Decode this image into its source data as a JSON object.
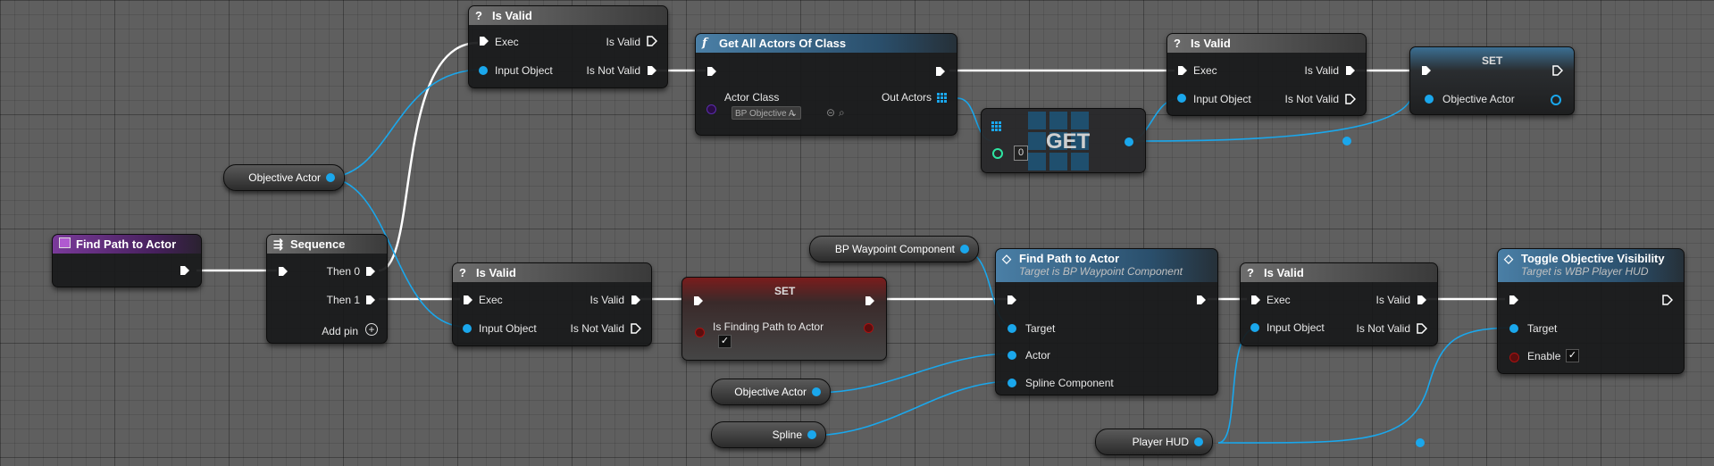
{
  "nodes": {
    "is_valid_1": {
      "title": "Is Valid",
      "exec": "Exec",
      "input": "Input Object",
      "out_valid": "Is Valid",
      "out_not_valid": "Is Not Valid"
    },
    "get_all_actors": {
      "title": "Get All Actors Of Class",
      "actor_class_label": "Actor Class",
      "actor_class_value": "BP Objective A",
      "out_actors": "Out Actors"
    },
    "is_valid_2": {
      "title": "Is Valid",
      "exec": "Exec",
      "input": "Input Object",
      "out_valid": "Is Valid",
      "out_not_valid": "Is Not Valid"
    },
    "set_objective": {
      "title": "SET",
      "var": "Objective Actor"
    },
    "get_node": {
      "title": "GET",
      "index": "0"
    },
    "var_objective_actor_top": "Objective Actor",
    "event_find_path": {
      "title": "Find Path to Actor"
    },
    "sequence": {
      "title": "Sequence",
      "then0": "Then 0",
      "then1": "Then 1",
      "add_pin": "Add pin"
    },
    "is_valid_3": {
      "title": "Is Valid",
      "exec": "Exec",
      "input": "Input Object",
      "out_valid": "Is Valid",
      "out_not_valid": "Is Not Valid"
    },
    "set_finding": {
      "title": "SET",
      "var": "Is Finding Path to Actor",
      "checked": true
    },
    "var_bp_waypoint": "BP Waypoint Component",
    "find_path_fn": {
      "title": "Find Path to Actor",
      "subtitle": "Target is BP Waypoint Component",
      "target": "Target",
      "actor": "Actor",
      "spline": "Spline Component"
    },
    "var_objective_actor_bottom": "Objective Actor",
    "var_spline": "Spline",
    "is_valid_4": {
      "title": "Is Valid",
      "exec": "Exec",
      "input": "Input Object",
      "out_valid": "Is Valid",
      "out_not_valid": "Is Not Valid"
    },
    "var_player_hud": "Player HUD",
    "toggle_visibility": {
      "title": "Toggle Objective Visibility",
      "subtitle": "Target is WBP Player HUD",
      "target": "Target",
      "enable": "Enable",
      "checked": true
    }
  },
  "colors": {
    "exec_wire": "#ffffff",
    "object_wire": "#1aa7ec",
    "function_header": "#4a7fa6",
    "event_header": "#7a3a9a"
  }
}
